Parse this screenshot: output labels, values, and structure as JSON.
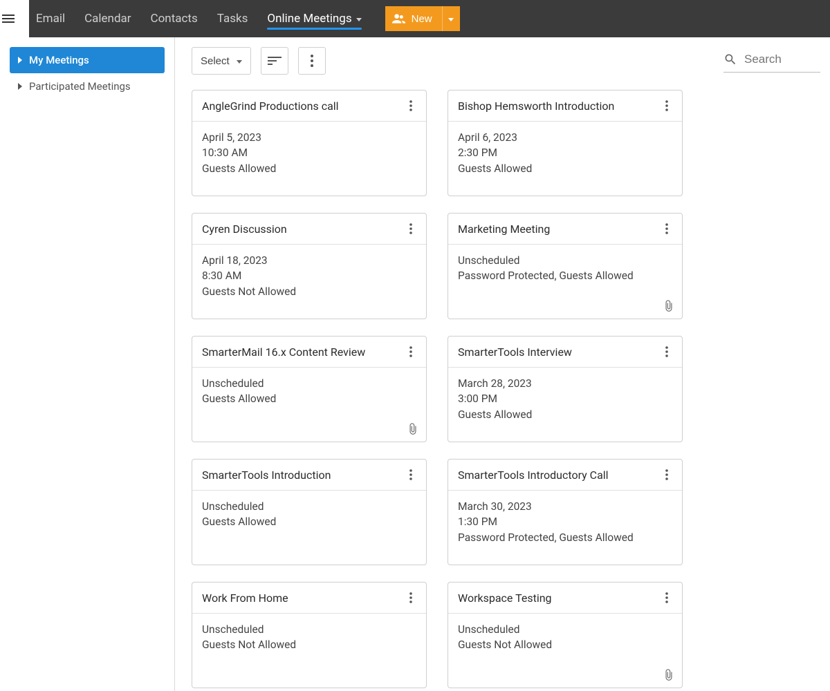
{
  "topnav": {
    "tabs": [
      "Email",
      "Calendar",
      "Contacts",
      "Tasks",
      "Online Meetings"
    ],
    "active_index": 4,
    "new_label": "New"
  },
  "sidebar": {
    "items": [
      {
        "label": "My Meetings",
        "active": true
      },
      {
        "label": "Participated Meetings",
        "active": false
      }
    ]
  },
  "toolbar": {
    "select_label": "Select"
  },
  "search": {
    "placeholder": "Search"
  },
  "meetings": [
    {
      "title": "AngleGrind Productions call",
      "line1": "April 5, 2023",
      "line2": "10:30 AM",
      "line3": "Guests Allowed",
      "attachment": false
    },
    {
      "title": "Bishop Hemsworth Introduction",
      "line1": "April 6, 2023",
      "line2": "2:30 PM",
      "line3": "Guests Allowed",
      "attachment": false
    },
    {
      "title": "Cyren Discussion",
      "line1": "April 18, 2023",
      "line2": "8:30 AM",
      "line3": "Guests Not Allowed",
      "attachment": false
    },
    {
      "title": "Marketing Meeting",
      "line1": "Unscheduled",
      "line2": "Password Protected, Guests Allowed",
      "line3": "",
      "attachment": true
    },
    {
      "title": "SmarterMail 16.x Content Review",
      "line1": "Unscheduled",
      "line2": "Guests Allowed",
      "line3": "",
      "attachment": true
    },
    {
      "title": "SmarterTools Interview",
      "line1": "March 28, 2023",
      "line2": "3:00 PM",
      "line3": "Guests Allowed",
      "attachment": false
    },
    {
      "title": "SmarterTools Introduction",
      "line1": "Unscheduled",
      "line2": "Guests Allowed",
      "line3": "",
      "attachment": false
    },
    {
      "title": "SmarterTools Introductory Call",
      "line1": "March 30, 2023",
      "line2": "1:30 PM",
      "line3": "Password Protected, Guests Allowed",
      "attachment": false
    },
    {
      "title": "Work From Home",
      "line1": "Unscheduled",
      "line2": "Guests Not Allowed",
      "line3": "",
      "attachment": false
    },
    {
      "title": "Workspace Testing",
      "line1": "Unscheduled",
      "line2": "Guests Not Allowed",
      "line3": "",
      "attachment": true
    }
  ]
}
